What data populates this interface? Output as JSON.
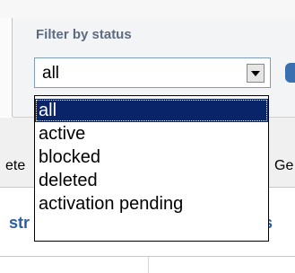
{
  "filter": {
    "label": "Filter by status",
    "selected": "all",
    "options": [
      "all",
      "active",
      "blocked",
      "deleted",
      "activation pending"
    ],
    "highlighted_index": 0
  },
  "background": {
    "toolbar_left_fragment": "ete",
    "toolbar_right_fragment": "Ge",
    "header_left_fragment": "str",
    "header_right_fragment": "s"
  },
  "icons": {
    "select_arrow": "chevron-down-icon",
    "right_toolbar_icon": "blue-action-icon"
  },
  "colors": {
    "highlight_bg": "#0a246a",
    "label_text": "#5d6b80",
    "link_text": "#2d5f9e"
  }
}
